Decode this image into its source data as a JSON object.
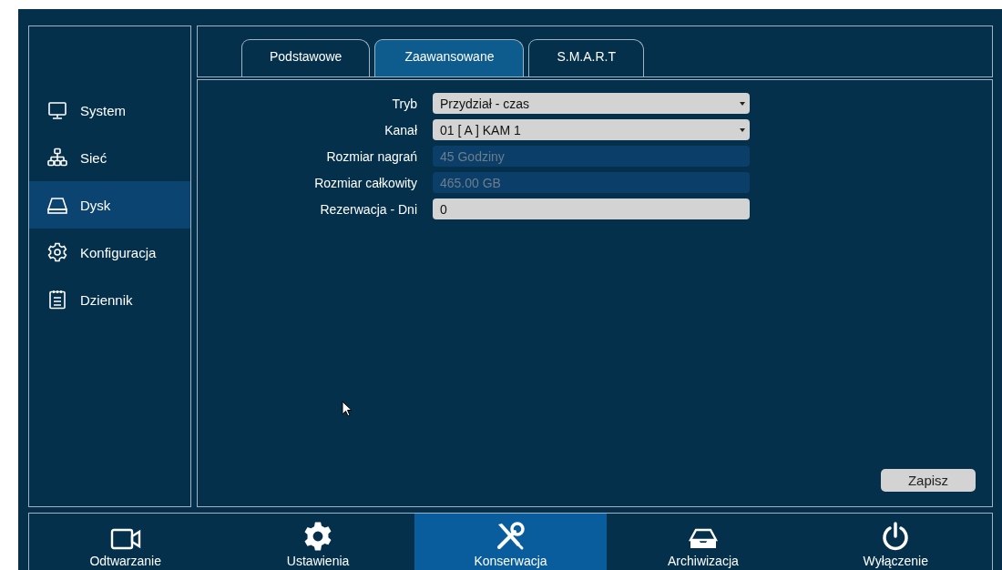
{
  "sidebar": {
    "items": [
      {
        "label": "System",
        "kind": "monitor",
        "selected": false
      },
      {
        "label": "Sieć",
        "kind": "network",
        "selected": false
      },
      {
        "label": "Dysk",
        "kind": "disk",
        "selected": true
      },
      {
        "label": "Konfiguracja",
        "kind": "gear",
        "selected": false
      },
      {
        "label": "Dziennik",
        "kind": "log",
        "selected": false
      }
    ]
  },
  "tabs": [
    {
      "label": "Podstawowe",
      "selected": false
    },
    {
      "label": "Zaawansowane",
      "selected": true
    },
    {
      "label": "S.M.A.R.T",
      "selected": false
    }
  ],
  "form": {
    "fields": [
      {
        "label": "Tryb",
        "kind": "select",
        "value": "Przydział - czas",
        "disabled": false
      },
      {
        "label": "Kanał",
        "kind": "select",
        "value": "01 [ A ] KAM 1",
        "disabled": false
      },
      {
        "label": "Rozmiar nagrań",
        "kind": "text",
        "value": "45 Godziny",
        "disabled": true
      },
      {
        "label": "Rozmiar całkowity",
        "kind": "text",
        "value": "465.00 GB",
        "disabled": true
      },
      {
        "label": "Rezerwacja - Dni",
        "kind": "text",
        "value": "0",
        "disabled": false
      }
    ]
  },
  "save_button": "Zapisz",
  "bottom_nav": [
    {
      "label": "Odtwarzanie",
      "kind": "camera",
      "selected": false
    },
    {
      "label": "Ustawienia",
      "kind": "gear",
      "selected": false
    },
    {
      "label": "Konserwacja",
      "kind": "tools",
      "selected": true
    },
    {
      "label": "Archiwizacja",
      "kind": "tray",
      "selected": false
    },
    {
      "label": "Wyłączenie",
      "kind": "power",
      "selected": false
    }
  ]
}
